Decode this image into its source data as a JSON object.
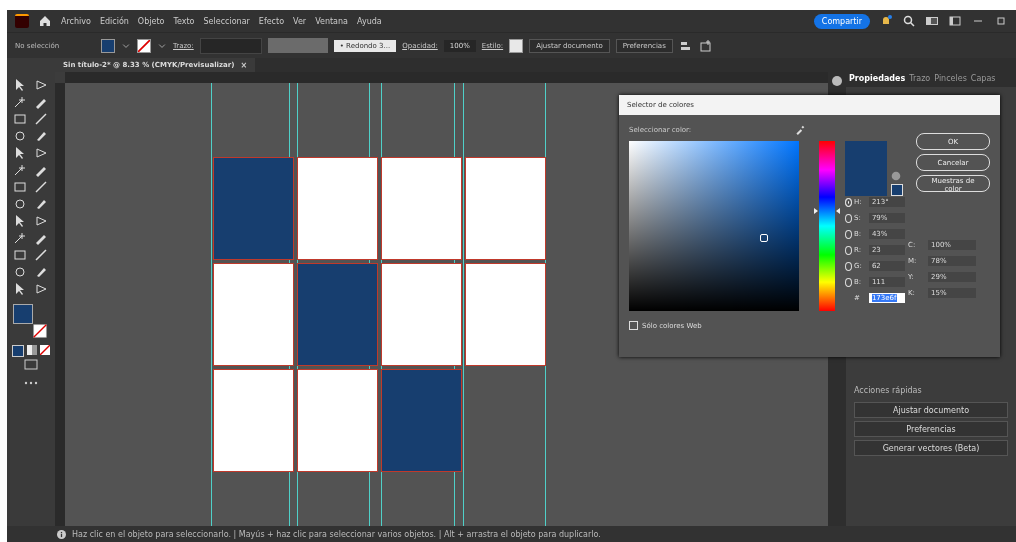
{
  "menu_bar": {
    "menus": [
      "Archivo",
      "Edición",
      "Objeto",
      "Texto",
      "Seleccionar",
      "Efecto",
      "Ver",
      "Ventana",
      "Ayuda"
    ],
    "share_button": "Compartir"
  },
  "control_bar": {
    "selection": "No selección",
    "stroke_label": "Trazo:",
    "brush": "• Redondo 3...",
    "opacity_label": "Opacidad:",
    "opacity": "100%",
    "style_label": "Estilo:",
    "buttons": [
      "Ajustar documento",
      "Preferencias"
    ]
  },
  "document_tab": {
    "title": "Sin título-2* @ 8.33 % (CMYK/Previsualizar)",
    "close": "×"
  },
  "canvas": {
    "tiles": [
      [
        {
          "color": "#173e6f"
        },
        {
          "color": "#ffffff"
        },
        {
          "color": "#ffffff"
        },
        {
          "color": "#ffffff"
        }
      ],
      [
        {
          "color": "#ffffff"
        },
        {
          "color": "#173e6f"
        },
        {
          "color": "#ffffff"
        },
        {
          "color": "#ffffff"
        }
      ],
      [
        {
          "color": "#ffffff"
        },
        {
          "color": "#ffffff"
        },
        {
          "color": "#173e6f"
        }
      ]
    ]
  },
  "right_panel": {
    "tabs": [
      {
        "label": "Propiedades",
        "selected": true
      },
      {
        "label": "Trazo",
        "selected": false
      },
      {
        "label": "Pinceles",
        "selected": false
      },
      {
        "label": "Capas",
        "selected": false
      }
    ],
    "quick_actions": {
      "title": "Acciones rápidas",
      "buttons": [
        "Ajustar documento",
        "Preferencias",
        "Generar vectores (Beta)"
      ]
    }
  },
  "color_picker": {
    "title": "Selector de colores",
    "prompt": "Seleccionar color:",
    "color": "#173e6f",
    "hue_slider": {
      "level": 0.59
    },
    "buttons": [
      "OK",
      "Cancelar",
      "Muestras de color"
    ],
    "fields": [
      {
        "label": "H:",
        "value": "213°",
        "selected": true
      },
      {
        "label": "S:",
        "value": "79%",
        "selected": false
      },
      {
        "label": "B:",
        "value": "43%",
        "selected": false
      },
      {
        "label": "R:",
        "value": "23",
        "selected": false
      },
      {
        "label": "G:",
        "value": "62",
        "selected": false
      },
      {
        "label": "B:",
        "value": "111",
        "selected": false
      }
    ],
    "cmyk": [
      {
        "label": "C:",
        "value": "100%"
      },
      {
        "label": "M:",
        "value": "78%"
      },
      {
        "label": "Y:",
        "value": "29%"
      },
      {
        "label": "K:",
        "value": "15%"
      }
    ],
    "hex_label": "#",
    "hex": "173e6f",
    "web_only": {
      "label": "Sólo colores Web",
      "checked": false
    }
  },
  "status_bar": {
    "text": "Haz clic en el objeto para seleccionarlo. | Mayús + haz clic para seleccionar varios objetos. | Alt + arrastra el objeto para duplicarlo."
  }
}
